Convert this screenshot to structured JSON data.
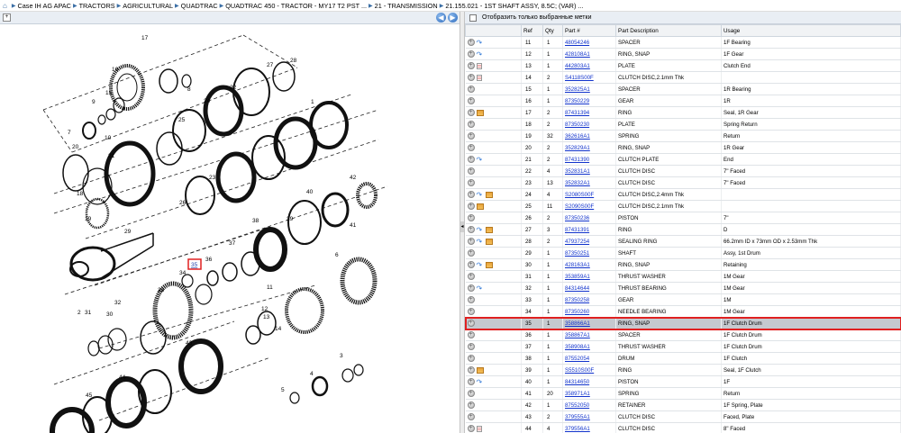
{
  "breadcrumb": {
    "home": "⌂",
    "items": [
      "Case IH AG APAC",
      "TRACTORS",
      "AGRICULTURAL",
      "QUADTRAC",
      "QUADTRAC 450 - TRACTOR - MY17 T2 PST ...",
      "21 - TRANSMISSION",
      "21.155.021 - 1ST SHAFT ASSY, 8.5C; (VAR) ..."
    ]
  },
  "diagram_toolbar": {
    "tool_icon": "+",
    "prev_icon": "◀",
    "next_icon": "▶"
  },
  "filter": {
    "label": "Отобразить только выбранные метки"
  },
  "columns": [
    "",
    "Ref",
    "Qty",
    "Part #",
    "Part Description",
    "Usage"
  ],
  "rows": [
    {
      "icons": [
        "plus",
        "link"
      ],
      "ref": "11",
      "qty": "1",
      "part": "48054246",
      "desc": "SPACER",
      "usage": "1F Bearing"
    },
    {
      "icons": [
        "plus",
        "link"
      ],
      "ref": "12",
      "qty": "1",
      "part": "428108A1",
      "desc": "RING, SNAP",
      "usage": "1F Gear"
    },
    {
      "icons": [
        "plus",
        "doc"
      ],
      "ref": "13",
      "qty": "1",
      "part": "442803A1",
      "desc": "PLATE",
      "usage": "Clutch End"
    },
    {
      "icons": [
        "plus",
        "doc"
      ],
      "ref": "14",
      "qty": "2",
      "part": "S4118S00F",
      "desc": "CLUTCH DISC,2.1mm Thk",
      "usage": ""
    },
    {
      "icons": [
        "plus"
      ],
      "ref": "15",
      "qty": "1",
      "part": "352825A1",
      "desc": "SPACER",
      "usage": "1R Bearing"
    },
    {
      "icons": [
        "plus"
      ],
      "ref": "16",
      "qty": "1",
      "part": "87350229",
      "desc": "GEAR",
      "usage": "1R"
    },
    {
      "icons": [
        "plus",
        "book"
      ],
      "ref": "17",
      "qty": "2",
      "part": "87431394",
      "desc": "RING",
      "usage": "Seal, 1R Gear"
    },
    {
      "icons": [
        "plus"
      ],
      "ref": "18",
      "qty": "2",
      "part": "87350230",
      "desc": "PLATE",
      "usage": "Spring Return"
    },
    {
      "icons": [
        "plus"
      ],
      "ref": "19",
      "qty": "32",
      "part": "362616A1",
      "desc": "SPRING",
      "usage": "Return"
    },
    {
      "icons": [
        "plus"
      ],
      "ref": "20",
      "qty": "2",
      "part": "352829A1",
      "desc": "RING, SNAP",
      "usage": "1R Gear"
    },
    {
      "icons": [
        "plus",
        "link"
      ],
      "ref": "21",
      "qty": "2",
      "part": "87431390",
      "desc": "CLUTCH PLATE",
      "usage": "End"
    },
    {
      "icons": [
        "plus"
      ],
      "ref": "22",
      "qty": "4",
      "part": "352831A1",
      "desc": "CLUTCH DISC",
      "usage": "7\" Faced"
    },
    {
      "icons": [
        "plus"
      ],
      "ref": "23",
      "qty": "13",
      "part": "352832A1",
      "desc": "CLUTCH DISC",
      "usage": "7\" Faced"
    },
    {
      "icons": [
        "plus",
        "link",
        "book"
      ],
      "ref": "24",
      "qty": "4",
      "part": "S2080S00F",
      "desc": "CLUTCH DISC,2.4mm Thk",
      "usage": ""
    },
    {
      "icons": [
        "plus",
        "book"
      ],
      "ref": "25",
      "qty": "11",
      "part": "S2090S00F",
      "desc": "CLUTCH DISC,2.1mm Thk",
      "usage": ""
    },
    {
      "icons": [
        "plus"
      ],
      "ref": "26",
      "qty": "2",
      "part": "87350236",
      "desc": "PISTON",
      "usage": "7\""
    },
    {
      "icons": [
        "plus",
        "link",
        "book"
      ],
      "ref": "27",
      "qty": "3",
      "part": "87431391",
      "desc": "RING",
      "usage": "D"
    },
    {
      "icons": [
        "plus",
        "link",
        "book"
      ],
      "ref": "28",
      "qty": "2",
      "part": "47937254",
      "desc": "SEALING RING",
      "usage": "66.2mm ID x 73mm OD x 2.53mm Thk"
    },
    {
      "icons": [
        "plus"
      ],
      "ref": "29",
      "qty": "1",
      "part": "87350251",
      "desc": "SHAFT",
      "usage": "Assy, 1st Drum"
    },
    {
      "icons": [
        "plus",
        "link",
        "book"
      ],
      "ref": "30",
      "qty": "1",
      "part": "428163A1",
      "desc": "RING, SNAP",
      "usage": "Retaining"
    },
    {
      "icons": [
        "plus"
      ],
      "ref": "31",
      "qty": "1",
      "part": "353859A1",
      "desc": "THRUST WASHER",
      "usage": "1M Gear"
    },
    {
      "icons": [
        "plus",
        "link"
      ],
      "ref": "32",
      "qty": "1",
      "part": "84314644",
      "desc": "THRUST BEARING",
      "usage": "1M Gear"
    },
    {
      "icons": [
        "plus"
      ],
      "ref": "33",
      "qty": "1",
      "part": "87350258",
      "desc": "GEAR",
      "usage": "1M"
    },
    {
      "icons": [
        "plus"
      ],
      "ref": "34",
      "qty": "1",
      "part": "87350260",
      "desc": "NEEDLE BEARING",
      "usage": "1M Gear"
    },
    {
      "icons": [
        "plus"
      ],
      "ref": "35",
      "qty": "1",
      "part": "358866A1",
      "desc": "RING, SNAP",
      "usage": "1F Clutch Drum",
      "selected": true
    },
    {
      "icons": [
        "plus"
      ],
      "ref": "36",
      "qty": "1",
      "part": "358867A1",
      "desc": "SPACER",
      "usage": "1F Clutch Drum"
    },
    {
      "icons": [
        "plus"
      ],
      "ref": "37",
      "qty": "1",
      "part": "358908A1",
      "desc": "THRUST WASHER",
      "usage": "1F Clutch Drum"
    },
    {
      "icons": [
        "plus"
      ],
      "ref": "38",
      "qty": "1",
      "part": "87552054",
      "desc": "DRUM",
      "usage": "1F Clutch"
    },
    {
      "icons": [
        "plus",
        "book"
      ],
      "ref": "39",
      "qty": "1",
      "part": "S5510S00F",
      "desc": "RING",
      "usage": "Seal, 1F Clutch"
    },
    {
      "icons": [
        "plus",
        "link"
      ],
      "ref": "40",
      "qty": "1",
      "part": "84314650",
      "desc": "PISTON",
      "usage": "1F"
    },
    {
      "icons": [
        "plus"
      ],
      "ref": "41",
      "qty": "20",
      "part": "358971A1",
      "desc": "SPRING",
      "usage": "Return"
    },
    {
      "icons": [
        "plus"
      ],
      "ref": "42",
      "qty": "1",
      "part": "87552050",
      "desc": "RETAINER",
      "usage": "1F Spring, Plate"
    },
    {
      "icons": [
        "plus"
      ],
      "ref": "43",
      "qty": "2",
      "part": "379555A1",
      "desc": "CLUTCH DISC",
      "usage": "Faced, Plate"
    },
    {
      "icons": [
        "plus",
        "doc"
      ],
      "ref": "44",
      "qty": "4",
      "part": "379556A1",
      "desc": "CLUTCH DISC",
      "usage": "8\" Faced"
    }
  ],
  "callouts": [
    "16",
    "17",
    "8",
    "15",
    "9",
    "7",
    "10",
    "27",
    "28",
    "22",
    "1",
    "24",
    "25",
    "20",
    "21",
    "23",
    "26",
    "18",
    "19",
    "42",
    "40",
    "41",
    "39",
    "38",
    "37",
    "36",
    "35",
    "34",
    "33",
    "6",
    "11",
    "12",
    "13",
    "14",
    "5",
    "4",
    "3",
    "2",
    "31",
    "32",
    "30",
    "29",
    "43",
    "44",
    "45"
  ],
  "highlighted_callout": "35"
}
